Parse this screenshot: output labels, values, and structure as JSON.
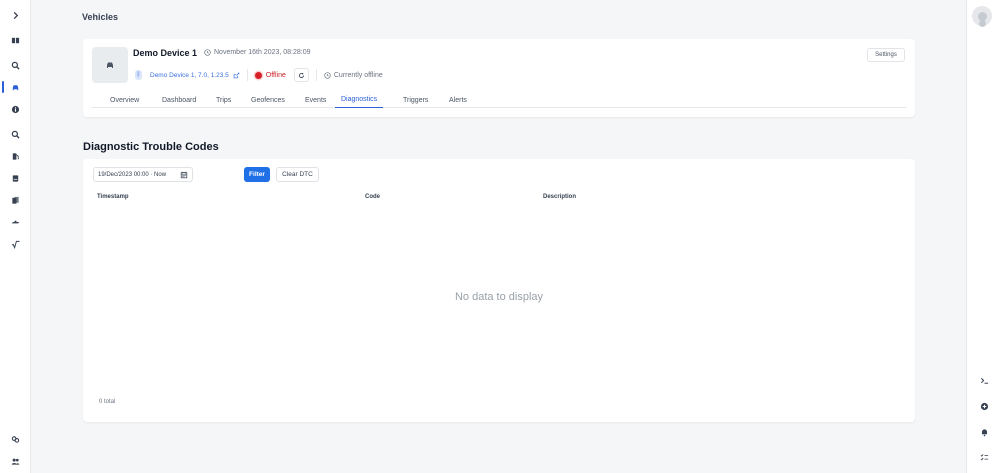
{
  "header": {
    "title": "Vehicles"
  },
  "left_nav": [
    {
      "icon": "chevron-right-icon"
    },
    {
      "icon": "dashboard-icon"
    },
    {
      "icon": "search-icon"
    },
    {
      "icon": "car-icon",
      "active": true
    },
    {
      "icon": "info-icon"
    },
    {
      "icon": "search-icon"
    },
    {
      "icon": "fuel-icon"
    },
    {
      "icon": "storage-icon"
    },
    {
      "icon": "files-icon"
    },
    {
      "icon": "plugin-icon"
    },
    {
      "icon": "sqrt-icon"
    },
    {
      "icon": "integrations-icon"
    },
    {
      "icon": "users-icon"
    }
  ],
  "right_nav": [
    "avatar",
    "terminal-icon",
    "add-circle-icon",
    "bell-icon",
    "checklist-icon"
  ],
  "device": {
    "name": "Demo Device 1",
    "timestamp": "November 16th 2023, 08:28:09",
    "link": "Demo Device 1, 7.0, 1.23.5",
    "status": "Offline",
    "connection": "Currently offline",
    "settings_label": "Settings"
  },
  "tabs": [
    {
      "label": "Overview"
    },
    {
      "label": "Dashboard"
    },
    {
      "label": "Trips"
    },
    {
      "label": "Geofences"
    },
    {
      "label": "Events"
    },
    {
      "label": "Diagnostics",
      "active": true
    },
    {
      "label": "Triggers"
    },
    {
      "label": "Alerts"
    }
  ],
  "dtc": {
    "title": "Diagnostic Trouble Codes",
    "date_range": "19/Dec/2023 00:00 · Now",
    "filter_label": "Filter",
    "clear_label": "Clear DTC",
    "columns": [
      "Timestamp",
      "Code",
      "Description"
    ],
    "empty_message": "No data to display",
    "total": "0 total"
  },
  "colors": {
    "accent": "#2b5fd9",
    "primary_button": "#1f6fe6",
    "status_offline": "#d61f26"
  }
}
